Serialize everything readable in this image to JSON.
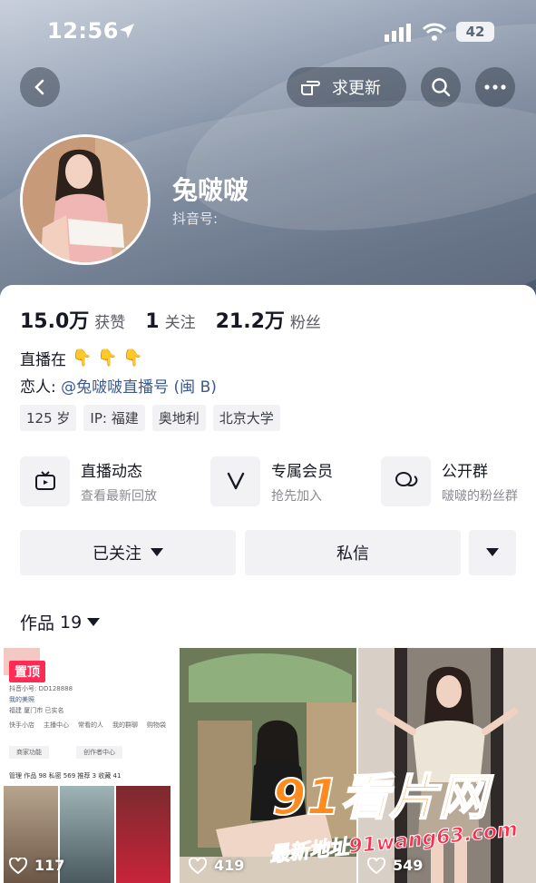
{
  "status_bar": {
    "time": "12:56",
    "battery": "42"
  },
  "header": {
    "update_button": "求更新"
  },
  "profile": {
    "name": "兔啵啵",
    "douyin_id_label": "抖音号:"
  },
  "stats": [
    {
      "value": "15.0万",
      "label": "获赞"
    },
    {
      "value": "1",
      "label": "关注"
    },
    {
      "value": "21.2万",
      "label": "粉丝"
    }
  ],
  "bio": {
    "line1": "直播在",
    "emojis": "👇 👇 👇",
    "line2_prefix": "恋人: ",
    "line2_link": "@兔啵啵直播号 (闽 B)"
  },
  "tags": [
    "125 岁",
    "IP: 福建",
    "奥地利",
    "北京大学"
  ],
  "features": [
    {
      "title": "直播动态",
      "subtitle": "查看最新回放",
      "icon": "tv-icon"
    },
    {
      "title": "专属会员",
      "subtitle": "抢先加入",
      "icon": "v-icon"
    },
    {
      "title": "公开群",
      "subtitle": "啵啵的粉丝群",
      "icon": "chat-icon"
    }
  ],
  "actions": {
    "follow": "已关注",
    "message": "私信"
  },
  "works": {
    "label": "作品",
    "count": "19"
  },
  "grid": [
    {
      "likes": "117",
      "pinned": "置顶"
    },
    {
      "likes": "419"
    },
    {
      "likes": "549"
    }
  ],
  "mini_screen": {
    "id_line": "抖音小号: DD128888",
    "lines": [
      "我的美照",
      "福建  厦门市  已实名",
      "商家功能",
      "创作者中心",
      "管理  作品 98  私密 569  推荐 3  收藏 41"
    ],
    "menu": [
      "快手小店",
      "主播中心",
      "常看的人",
      "我的群聊",
      "购物袋"
    ]
  },
  "watermark": {
    "line1": "91看片网",
    "line2": "最新地址91wang63.com"
  }
}
